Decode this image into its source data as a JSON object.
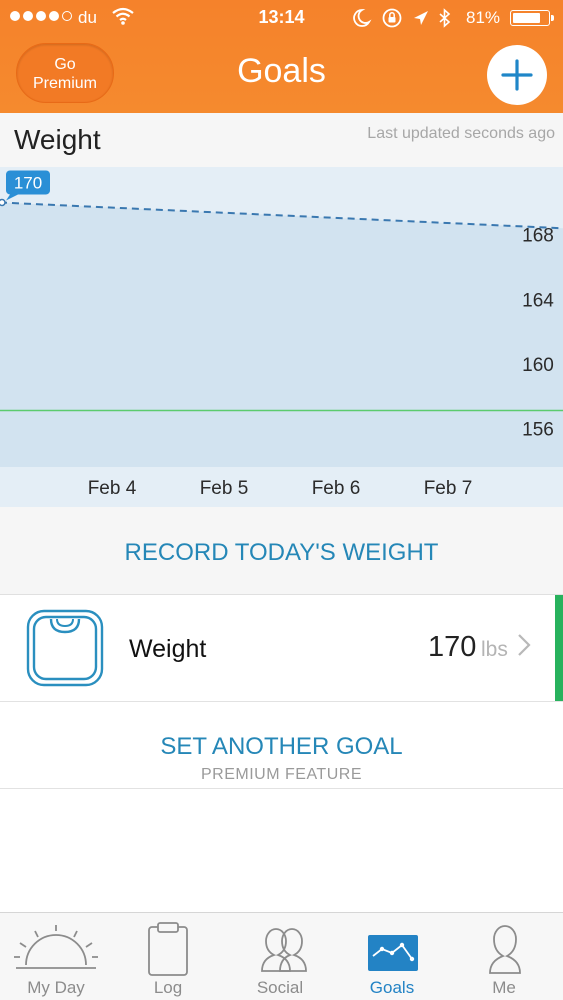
{
  "status_bar": {
    "carrier": "du",
    "time": "13:14",
    "battery_percent": "81%",
    "battery_level": 0.81,
    "signal_bars_filled": 4,
    "signal_bars_total": 5
  },
  "header": {
    "premium_line1": "Go",
    "premium_line2": "Premium",
    "title": "Goals",
    "add_icon": "plus-icon"
  },
  "chart_card": {
    "title": "Weight",
    "last_updated": "Last updated seconds ago"
  },
  "chart_data": {
    "type": "line",
    "title": "Weight",
    "current_label": "170",
    "x_ticks": [
      "Feb 4",
      "Feb 5",
      "Feb 6",
      "Feb 7"
    ],
    "y_ticks": [
      168,
      164,
      160,
      156
    ],
    "ylim": [
      153.6,
      172.2
    ],
    "series": [
      {
        "x": [
          "Feb 3",
          "Feb 8"
        ],
        "values": [
          170,
          168.4
        ],
        "style": "dashed"
      }
    ],
    "goal_line": 157.1,
    "colors": {
      "line": "#3a78b0",
      "goal": "#5ccb6e",
      "fill": "#cfe1ee",
      "background": "#e4eef6"
    },
    "grid": false
  },
  "actions": {
    "record_label": "RECORD TODAY'S WEIGHT",
    "another_goal_label": "SET ANOTHER GOAL",
    "another_goal_sub": "PREMIUM FEATURE"
  },
  "goal": {
    "icon": "scale-icon",
    "label": "Weight",
    "value": "170",
    "unit": "lbs",
    "status_color": "#28b25d"
  },
  "tabs": [
    {
      "label": "My Day",
      "icon": "sunrise-icon",
      "active": false
    },
    {
      "label": "Log",
      "icon": "clipboard-icon",
      "active": false
    },
    {
      "label": "Social",
      "icon": "people-icon",
      "active": false
    },
    {
      "label": "Goals",
      "icon": "graph-icon",
      "active": true
    },
    {
      "label": "Me",
      "icon": "person-icon",
      "active": false
    }
  ],
  "colors": {
    "brand_orange": "#f5822b",
    "accent_blue": "#2587b7",
    "active_tab": "#2383c5"
  }
}
